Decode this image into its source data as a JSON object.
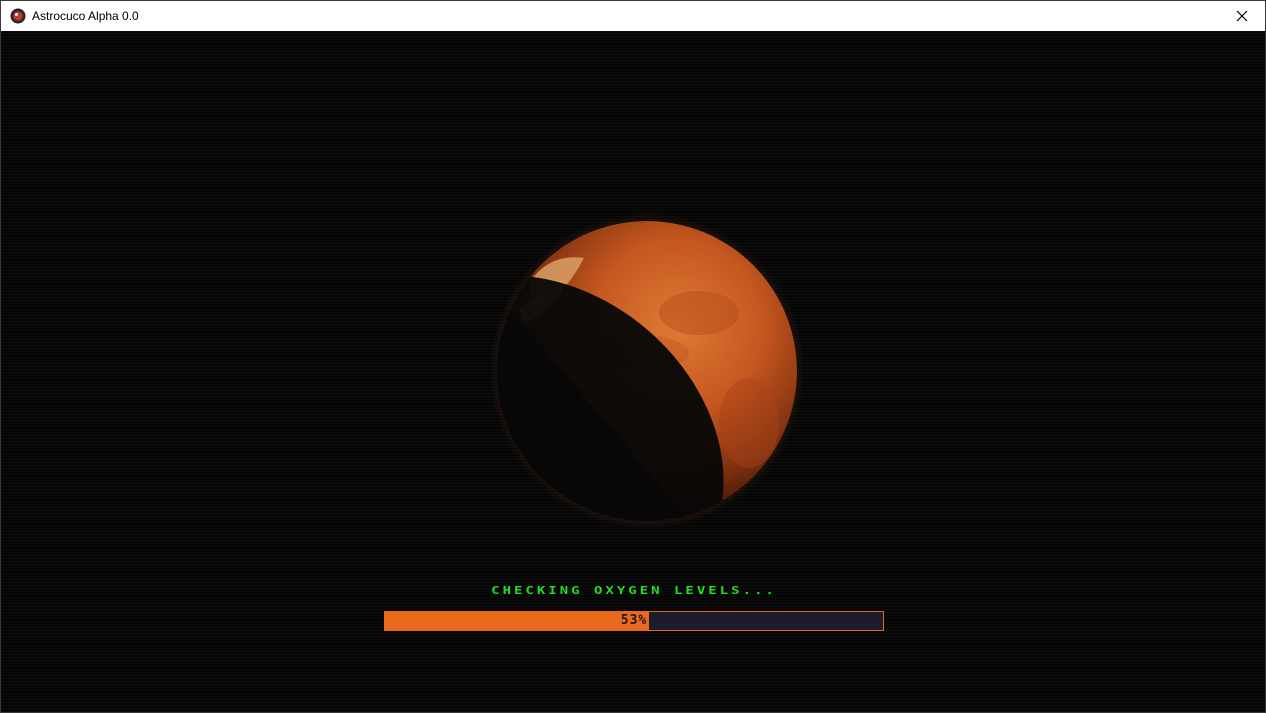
{
  "window": {
    "title": "Astrocuco Alpha 0.0",
    "icons": {
      "app": "astrocuco-app-icon",
      "close": "close-icon"
    }
  },
  "scene": {
    "planet": "mars-planet"
  },
  "loading": {
    "status_text": "CHECKING OXYGEN LEVELS...",
    "progress_value": 53,
    "progress_label": "53%",
    "colors": {
      "accent": "#e8681c",
      "text": "#22dd22",
      "track": "#1c1c2a"
    }
  }
}
